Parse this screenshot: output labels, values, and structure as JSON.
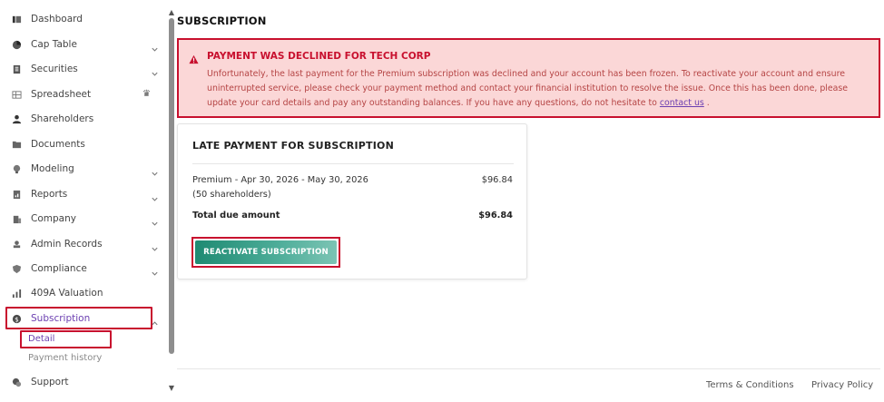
{
  "sidebar": {
    "items": [
      {
        "label": "Dashboard"
      },
      {
        "label": "Cap Table"
      },
      {
        "label": "Securities"
      },
      {
        "label": "Spreadsheet"
      },
      {
        "label": "Shareholders"
      },
      {
        "label": "Documents"
      },
      {
        "label": "Modeling"
      },
      {
        "label": "Reports"
      },
      {
        "label": "Company"
      },
      {
        "label": "Admin Records"
      },
      {
        "label": "Compliance"
      },
      {
        "label": "409A Valuation"
      },
      {
        "label": "Subscription"
      },
      {
        "label": "Support"
      }
    ],
    "subitems": [
      {
        "label": "Detail"
      },
      {
        "label": "Payment history"
      }
    ]
  },
  "page": {
    "title": "SUBSCRIPTION"
  },
  "alert": {
    "title": "PAYMENT WAS DECLINED FOR TECH CORP",
    "body": "Unfortunately, the last payment for the Premium subscription was declined and your account has been frozen. To reactivate your account and ensure uninterrupted service, please check your payment method and contact your financial institution to resolve the issue. Once this has been done, please update your card details and pay any outstanding balances. If you have any questions, do not hesitate to",
    "link": "contact us",
    "end": "."
  },
  "card": {
    "title": "LATE PAYMENT FOR SUBSCRIPTION",
    "line_description": "Premium - Apr 30, 2026 - May 30, 2026",
    "line_detail": "(50 shareholders)",
    "line_amount": "$96.84",
    "total_label": "Total due amount",
    "total_amount": "$96.84",
    "button_label": "REACTIVATE SUBSCRIPTION"
  },
  "footer": {
    "terms": "Terms & Conditions",
    "privacy": "Privacy Policy"
  },
  "colors": {
    "accent": "#6b3fb1",
    "alert_red": "#c8102e",
    "alert_bg": "#fbd7d7",
    "button_teal": "#1e8a72"
  }
}
